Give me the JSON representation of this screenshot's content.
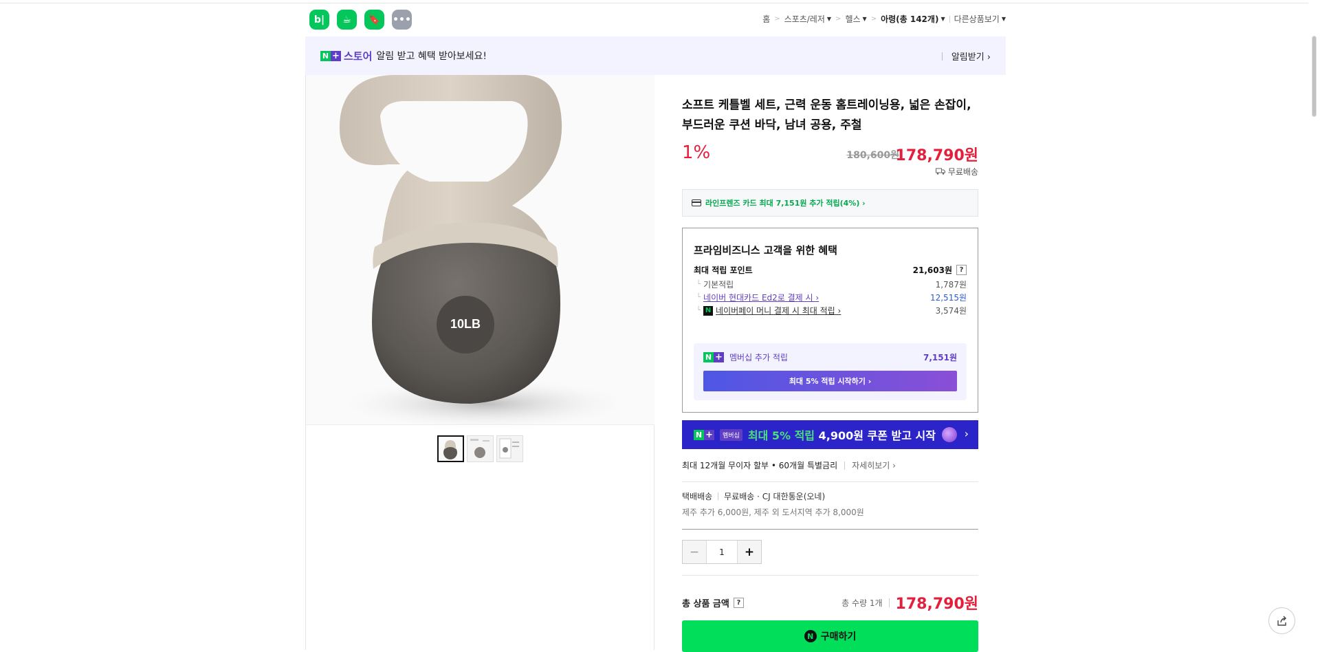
{
  "app_icons": [
    {
      "name": "blog",
      "glyph": "b|",
      "color": "#03c75a"
    },
    {
      "name": "cafe",
      "glyph": "☕",
      "color": "#03c75a"
    },
    {
      "name": "bookmark",
      "glyph": "🔖",
      "color": "#03c75a"
    },
    {
      "name": "more",
      "glyph": "•••",
      "color": "#9aa1ad"
    }
  ],
  "breadcrumb": {
    "home": "홈",
    "cat1": "스포츠/레저",
    "cat2": "헬스",
    "cat3": "아령(총 142개)",
    "other": "다른상품보기"
  },
  "banner": {
    "n": "N",
    "plus": "+",
    "store": "스토어",
    "message": "알림 받고 혜택 받아보세요!",
    "alarm": "알림받기 ›"
  },
  "product": {
    "image_label": "10LB",
    "title": "소프트 케틀벨 세트, 근력 운동 홈트레이닝용, 넓은 손잡이, 부드러운 쿠션 바닥, 남녀 공용, 주철",
    "discount": "1%",
    "original_price": "180,600원",
    "price": "178,790원",
    "shipping": "무료배송"
  },
  "card_benefit": "라인프렌즈 카드 최대 7,151원 추가 적립(4%) ›",
  "biz": {
    "heading": "프라임비즈니스 고객을 위한 혜택",
    "max_points_label": "최대 적립 포인트",
    "max_points_value": "21,603원",
    "help": "?",
    "rows": [
      {
        "label": "기본적립",
        "value": "1,787원"
      },
      {
        "label": "네이버 현대카드 Ed2로 결제 시 ›",
        "value": "12,515원"
      },
      {
        "label": "네이버페이 머니 결제 시 최대 적립 ›",
        "value": "3,574원"
      }
    ],
    "member_label": "멤버십 추가 적립",
    "member_value": "7,151원",
    "member_button": "최대 5% 적립 시작하기 ›"
  },
  "membership_banner": {
    "badge": "멤버십",
    "text_green": "최대 5% 적립",
    "text_white": "4,900원 쿠폰 받고 시작",
    "chevron": "›"
  },
  "installment": {
    "text": "최대 12개월 무이자 할부 • 60개월 특별금리",
    "more": "자세히보기 ›"
  },
  "delivery": {
    "type": "택배배송",
    "fee": "무료배송",
    "carrier": "· CJ 대한통운(오네)",
    "extra": "제주 추가 6,000원, 제주 외 도서지역 추가 8,000원"
  },
  "quantity": {
    "minus": "−",
    "value": "1",
    "plus": "+"
  },
  "total": {
    "label": "총 상품 금액",
    "help": "?",
    "count": "총 수량 1개",
    "sum": "178,790원"
  },
  "buy_button": {
    "icon": "N",
    "label": "구매하기"
  }
}
